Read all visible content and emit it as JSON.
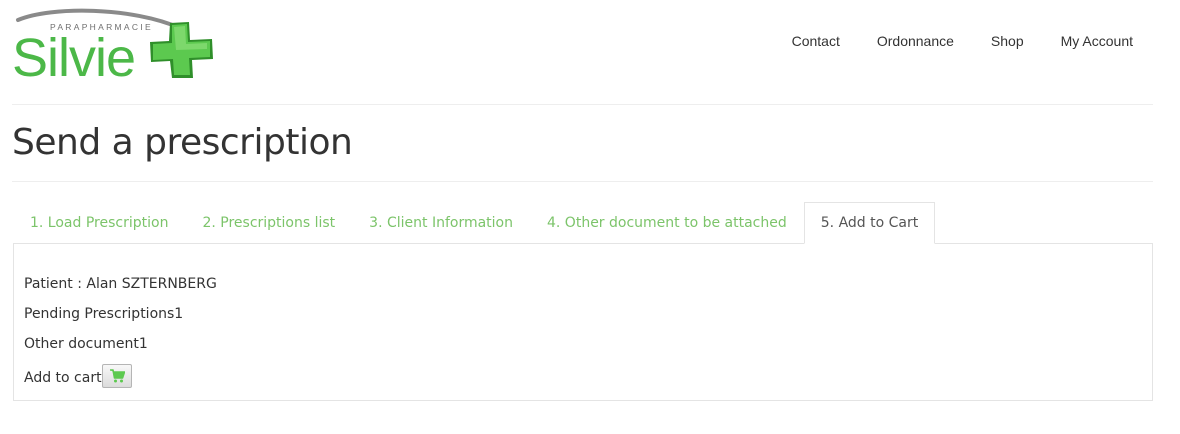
{
  "header": {
    "logo": {
      "tagline": "PARAPHARMACIE",
      "name": "Silvie"
    },
    "nav": [
      {
        "label": "Contact"
      },
      {
        "label": "Ordonnance"
      },
      {
        "label": "Shop"
      },
      {
        "label": "My Account"
      }
    ]
  },
  "page_title": "Send a prescription",
  "tabs": [
    {
      "label": "1. Load Prescription",
      "active": false
    },
    {
      "label": "2. Prescriptions list",
      "active": false
    },
    {
      "label": "3. Client Information",
      "active": false
    },
    {
      "label": "4. Other document to be attached",
      "active": false
    },
    {
      "label": "5. Add to Cart",
      "active": true
    }
  ],
  "summary": {
    "patient": "Patient : Alan SZTERNBERG",
    "pending": "Pending Prescriptions1",
    "other_document": "Other document1",
    "add_to_cart": "Add to cart",
    "cart_icon": "shopping-cart-icon"
  },
  "colors": {
    "brand_green": "#4cb848",
    "tab_link_green": "#7cc46a",
    "text": "#333333"
  }
}
